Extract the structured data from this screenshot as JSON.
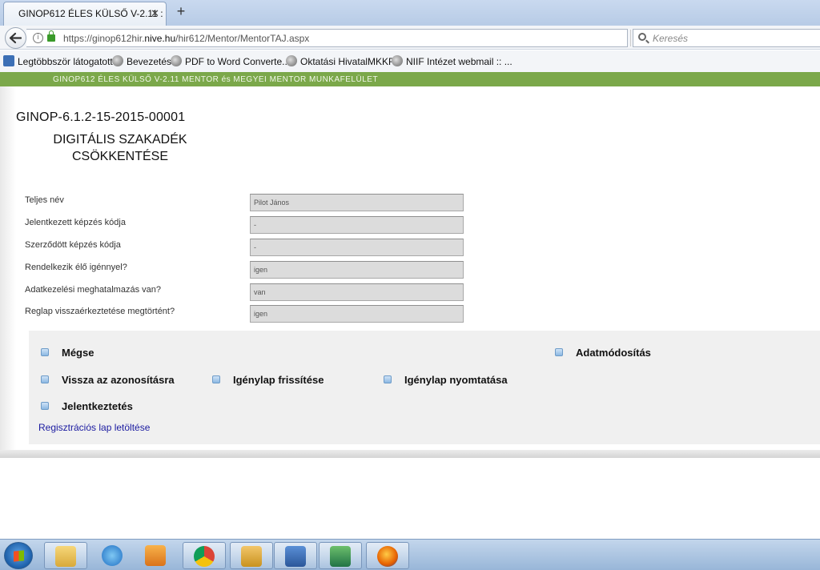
{
  "browser": {
    "tab_title": "GINOP612 ÉLES KÜLSŐ V-2.11 : ...",
    "tab_close": "✕",
    "new_tab": "+",
    "url_prefix": "https://ginop612hir.",
    "url_host": "nive.hu",
    "url_path": "/hir612/Mentor/MentorTAJ.aspx",
    "search_placeholder": "Keresés",
    "reload_glyph": "↻",
    "info_glyph": "i",
    "bookmarks": [
      {
        "label": "Legtöbbször látogatott",
        "icon": "bookmark-page-icon"
      },
      {
        "label": "Bevezetés",
        "icon": "globe-icon"
      },
      {
        "label": "PDF to Word Converte...",
        "icon": "globe-icon"
      },
      {
        "label": "Oktatási HivatalMKKR",
        "icon": "globe-icon"
      },
      {
        "label": "NIIF Intézet webmail :: ...",
        "icon": "globe-icon"
      }
    ]
  },
  "app": {
    "header_text": "GINOP612 ÉLES KÜLSŐ V-2.11 MENTOR és MEGYEI MENTOR MUNKAFELÜLET",
    "project_id": "GINOP-6.1.2-15-2015-00001",
    "project_title": "DIGITÁLIS SZAKADÉK CSÖKKENTÉSE"
  },
  "form": {
    "fields": [
      {
        "label": "Teljes név",
        "value": "Pilot János"
      },
      {
        "label": "Jelentkezett képzés kódja",
        "value": "-"
      },
      {
        "label": "Szerződött képzés kódja",
        "value": "-"
      },
      {
        "label": "Rendelkezik élő igénnyel?",
        "value": "igen"
      },
      {
        "label": "Adatkezelési meghatalmazás van?",
        "value": "van"
      },
      {
        "label": "Reglap visszaérkeztetése megtörtént?",
        "value": "igen"
      }
    ]
  },
  "actions": {
    "cancel": "Mégse",
    "modify": "Adatmódosítás",
    "back_to_id": "Vissza az azonosításra",
    "refresh_claim": "Igénylap frissítése",
    "print_claim": "Igénylap nyomtatása",
    "register": "Jelentkeztetés",
    "download_link": "Regisztrációs lap letöltése"
  },
  "taskbar": {
    "items": [
      "start-orb-icon",
      "explorer-icon",
      "internet-explorer-icon",
      "media-player-icon",
      "chrome-icon",
      "outlook-icon",
      "word-icon",
      "excel-icon",
      "firefox-icon"
    ]
  },
  "colors": {
    "header_green": "#7ba84a",
    "link_blue": "#1a1aa0",
    "field_bg": "#dcdcdc",
    "panel_bg": "#f0f0f0"
  }
}
